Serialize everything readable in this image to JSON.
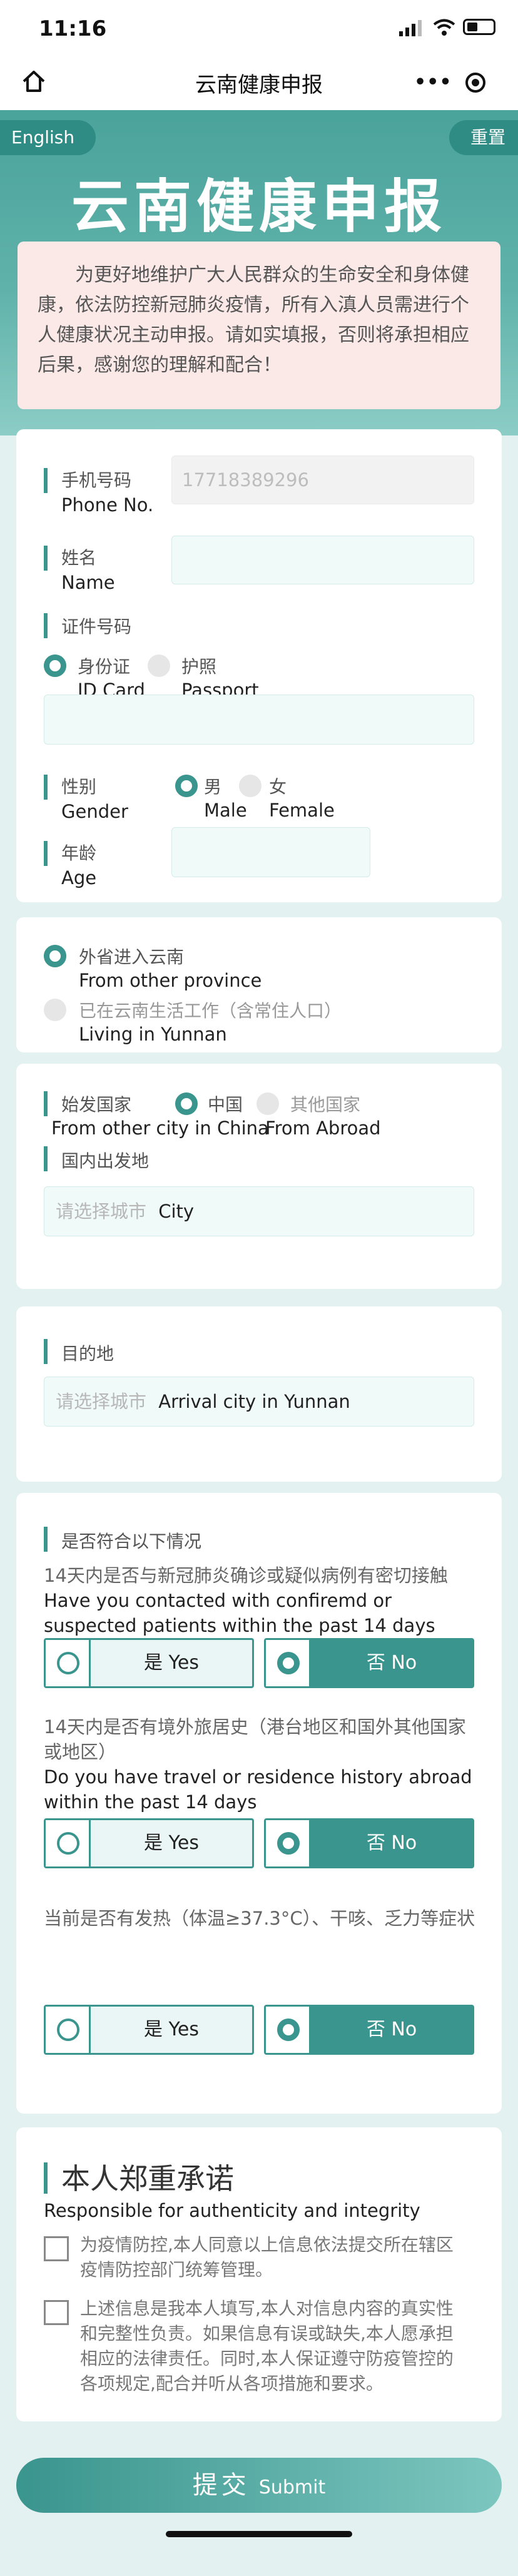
{
  "status": {
    "time": "11:16"
  },
  "nav": {
    "title": "云南健康申报",
    "more": "•••"
  },
  "header": {
    "lang": "English",
    "reset": "重置",
    "title": "云南健康申报",
    "notice": "为更好地维护广大人民群众的生命安全和身体健康，依法防控新冠肺炎疫情，所有入滇人员需进行个人健康状况主动申报。请如实填报，否则将承担相应后果，感谢您的理解和配合！"
  },
  "personal": {
    "phone": {
      "label": "手机号码",
      "en": "Phone No.",
      "value": "17718389296"
    },
    "name": {
      "label": "姓名",
      "en": "Name",
      "value": ""
    },
    "id": {
      "label": "证件号码",
      "opt1": "身份证",
      "opt1_en": "ID Card",
      "opt2": "护照",
      "opt2_en": "Passport",
      "selected": "身份证"
    },
    "gender": {
      "label": "性别",
      "en": "Gender",
      "male": "男",
      "male_en": "Male",
      "female": "女",
      "female_en": "Female",
      "selected": "男"
    },
    "age": {
      "label": "年龄",
      "en": "Age",
      "value": ""
    }
  },
  "origin": {
    "opt1": "外省进入云南",
    "opt1_en": "From other province",
    "opt2": "已在云南生活工作（含常住人口）",
    "opt2_en": "Living in Yunnan",
    "selected": "外省进入云南"
  },
  "departure": {
    "label": "始发国家",
    "label_en": "From other city in China",
    "china": "中国",
    "other": "其他国家",
    "other_en": "From Abroad",
    "selected": "中国",
    "domestic_label": "国内出发地",
    "placeholder": "请选择城市",
    "placeholder_en": "City"
  },
  "destination": {
    "label": "目的地",
    "placeholder": "请选择城市",
    "placeholder_en": "Arrival city in Yunnan"
  },
  "conditions": {
    "title": "是否符合以下情况",
    "questions": [
      {
        "cn": "14天内是否与新冠肺炎确诊或疑似病例有密切接触",
        "en": "Have you contacted with confiremd or suspected patients within the past 14 days",
        "answer": "否"
      },
      {
        "cn": "14天内是否有境外旅居史（港台地区和国外其他国家或地区）",
        "en": "Do you have travel or residence history abroad within the past 14 days",
        "answer": "否"
      },
      {
        "cn": "当前是否有发热（体温≥37.3°C）、干咳、乏力等症状",
        "en": "",
        "answer": "否"
      }
    ],
    "yes": "是",
    "yes_en": "Yes",
    "no": "否",
    "no_en": "No"
  },
  "pledge": {
    "title": "本人郑重承诺",
    "en": "Responsible for authenticity and integrity",
    "items": [
      "为疫情防控,本人同意以上信息依法提交所在辖区疫情防控部门统筹管理。",
      "上述信息是我本人填写,本人对信息内容的真实性和完整性负责。如果信息有误或缺失,本人愿承担相应的法律责任。同时,本人保证遵守防疫管控的各项规定,配合并听从各项措施和要求。"
    ]
  },
  "submit": {
    "cn": "提交",
    "en": "Submit"
  },
  "colors": {
    "accent": "#3a958e",
    "notice_bg": "#fbe9e8",
    "page_bg": "#e3f1f0"
  }
}
